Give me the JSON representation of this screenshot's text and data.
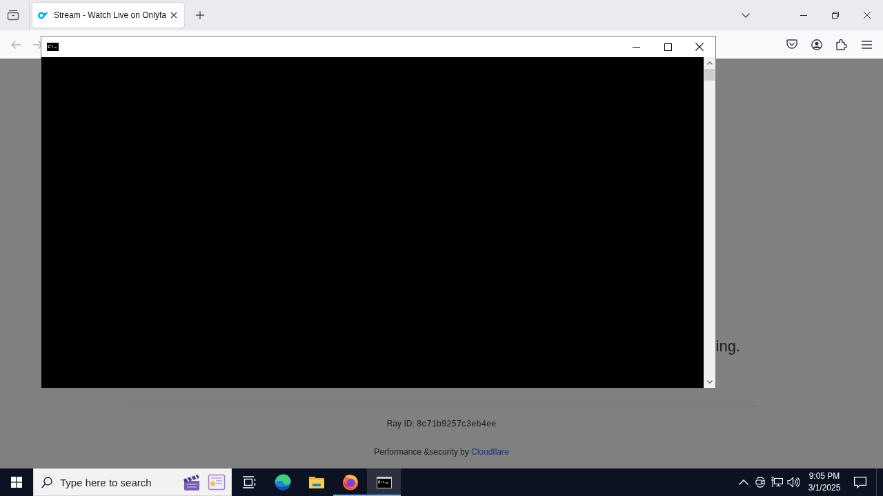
{
  "browser": {
    "tabs": [
      {
        "title": "Stream - Watch Live on Onlyfa",
        "selected": true
      }
    ],
    "nav_buttons": [
      {
        "kind": "back",
        "disabled": true
      },
      {
        "kind": "forward",
        "disabled": true
      }
    ]
  },
  "page": {
    "heading_tail": "ing.",
    "ray_id_label": "Ray ID:",
    "ray_id": "8c71b9257c3eb4ee",
    "footer_text": "Performance &security by",
    "footer_link": "Cloudflare"
  },
  "taskbar": {
    "search": {
      "placeholder": "Type here to search"
    },
    "apps": [
      {
        "kind": "task_view",
        "running": false,
        "selected": false
      },
      {
        "kind": "browser_swirl",
        "running": false,
        "selected": false
      },
      {
        "kind": "folder",
        "running": false,
        "selected": false
      },
      {
        "kind": "browser_fox",
        "running": true,
        "selected": false
      },
      {
        "kind": "terminal",
        "running": true,
        "selected": true
      }
    ],
    "clock": {
      "time": "9:05 PM",
      "date": "3/1/2025"
    }
  }
}
